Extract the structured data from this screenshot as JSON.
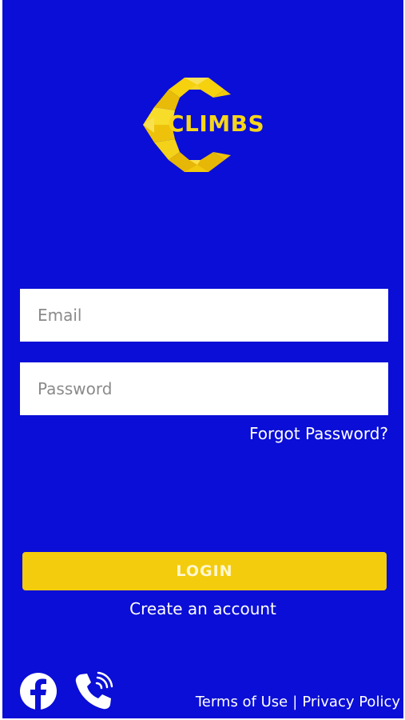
{
  "logo": {
    "text": "CLIMBS",
    "color": "#f7d51b"
  },
  "form": {
    "email_placeholder": "Email",
    "password_placeholder": "Password",
    "forgot_label": "Forgot Password?"
  },
  "actions": {
    "login_label": "LOGIN",
    "create_account_label": "Create an account"
  },
  "footer": {
    "icons": [
      "facebook-icon",
      "phone-icon"
    ],
    "terms_label": "Terms of Use",
    "separator": "|",
    "privacy_label": "Privacy Policy"
  },
  "colors": {
    "background": "#0a0ed6",
    "accent": "#f3cc0d",
    "text": "#ffffff"
  }
}
